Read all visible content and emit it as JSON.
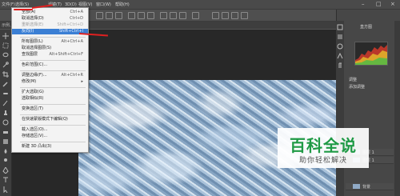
{
  "menubar": {
    "items": [
      {
        "label": "文件(F)"
      },
      {
        "label": "选择(S)"
      },
      {
        "label": "滤镜(T)"
      },
      {
        "label": "3D(D)"
      },
      {
        "label": "视图(V)"
      },
      {
        "label": "窗口(W)"
      },
      {
        "label": "帮助(H)"
      }
    ]
  },
  "document": {
    "tab_label": "示例.jpg"
  },
  "select_menu": {
    "items": [
      {
        "label": "全部(A)",
        "shortcut": "Ctrl+A"
      },
      {
        "label": "取消选择(D)",
        "shortcut": "Ctrl+D"
      },
      {
        "label": "重新选择(E)",
        "shortcut": "Shift+Ctrl+D"
      },
      {
        "label": "反向(I)",
        "shortcut": "Shift+Ctrl+I"
      },
      {
        "label": "所有图层(L)",
        "shortcut": "Alt+Ctrl+A"
      },
      {
        "label": "取消选择图层(S)",
        "shortcut": ""
      },
      {
        "label": "查找图层",
        "shortcut": "Alt+Shift+Ctrl+F"
      },
      {
        "label": "色彩范围(C)...",
        "shortcut": ""
      },
      {
        "label": "调整边缘(F)...",
        "shortcut": "Alt+Ctrl+R"
      },
      {
        "label": "修改(M)",
        "shortcut": ""
      },
      {
        "label": "扩大选取(G)",
        "shortcut": ""
      },
      {
        "label": "选取相似(R)",
        "shortcut": ""
      },
      {
        "label": "变换选区(T)",
        "shortcut": ""
      },
      {
        "label": "在快速蒙版模式下编辑(Q)",
        "shortcut": ""
      },
      {
        "label": "载入选区(O)...",
        "shortcut": ""
      },
      {
        "label": "存储选区(V)...",
        "shortcut": ""
      },
      {
        "label": "新建 3D 凸出(3)",
        "shortcut": ""
      }
    ]
  },
  "panels": {
    "histogram_title": "直方图",
    "adjust_title": "调整",
    "adjust_subtitle": "添加调整",
    "layers_title": "图层",
    "layers": [
      {
        "label": "图层 1"
      },
      {
        "label": "图层 1"
      },
      {
        "label": "背景"
      }
    ]
  },
  "watermark": {
    "title": "百科全说",
    "subtitle": "助你轻松解决"
  },
  "colors": {
    "highlight": "#3b7fd4",
    "annotation": "#e02020",
    "brand_green": "#1f9a45"
  }
}
